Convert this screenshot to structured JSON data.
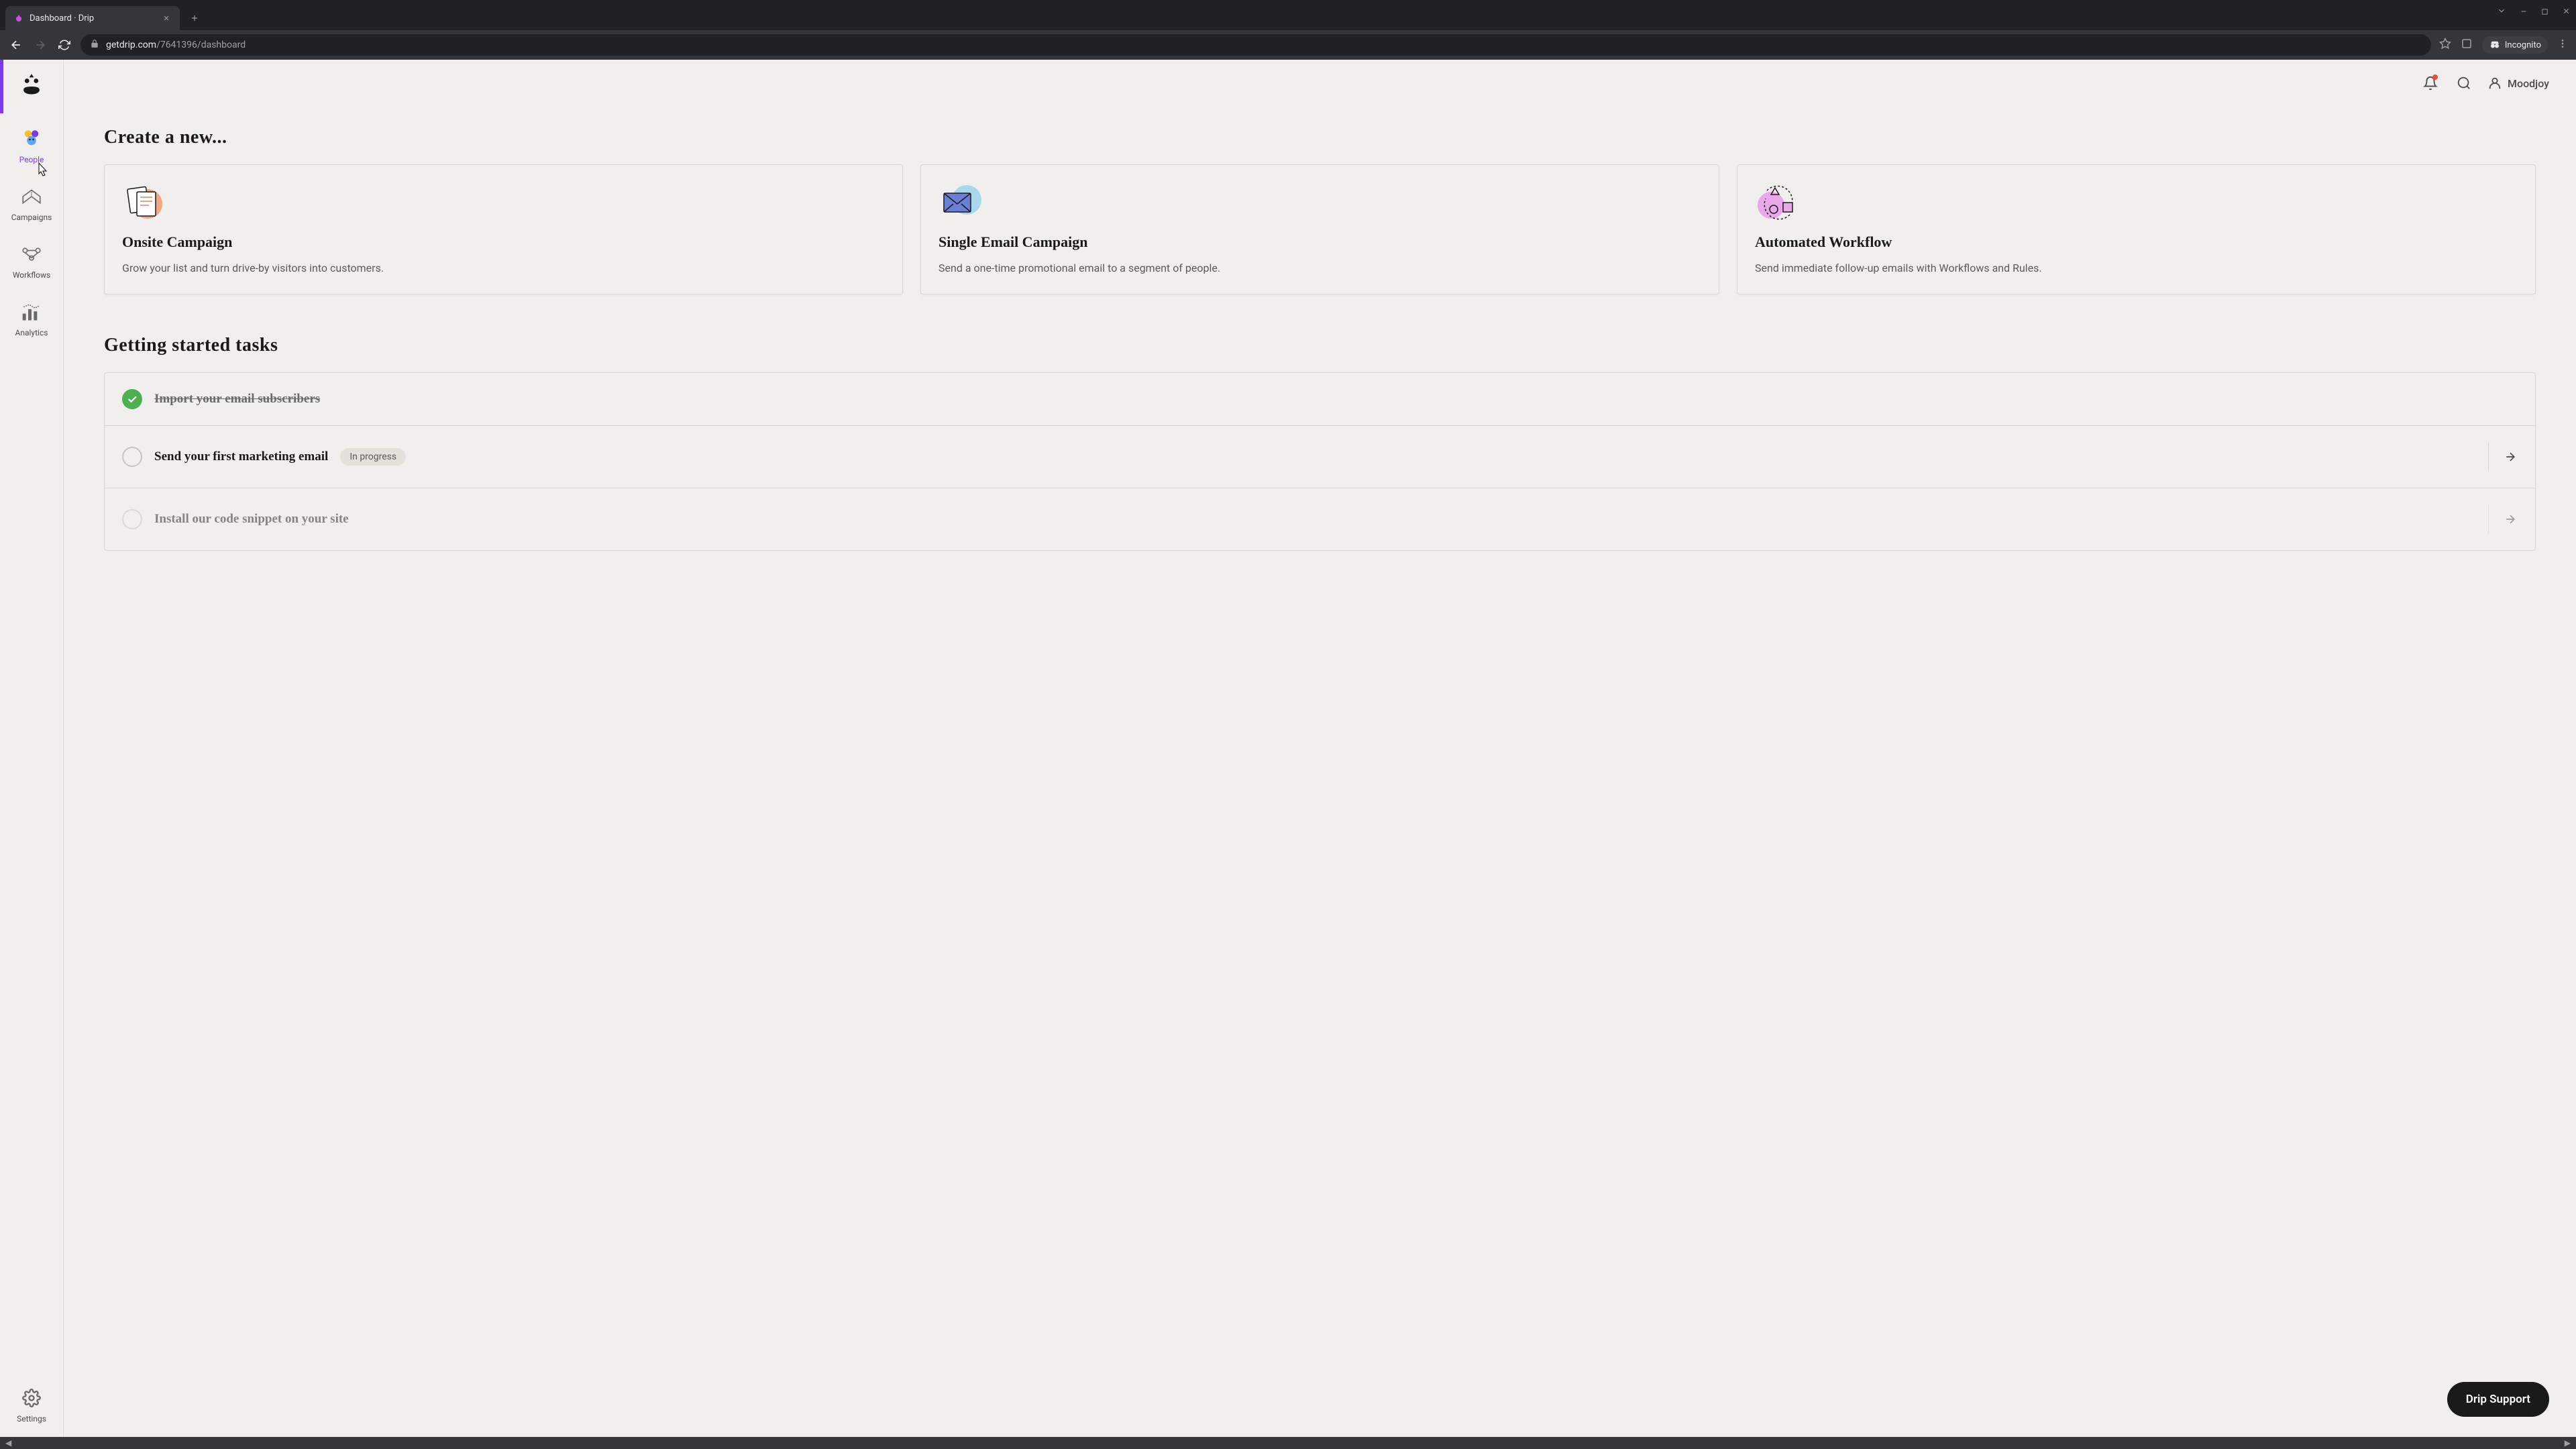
{
  "browser": {
    "tab_title": "Dashboard · Drip",
    "url_domain": "getdrip.com",
    "url_path": "/7641396/dashboard",
    "incognito_label": "Incognito"
  },
  "sidebar": {
    "items": [
      {
        "label": "People"
      },
      {
        "label": "Campaigns"
      },
      {
        "label": "Workflows"
      },
      {
        "label": "Analytics"
      }
    ],
    "settings_label": "Settings"
  },
  "topbar": {
    "username": "Moodjoy"
  },
  "sections": {
    "create_heading": "Create a new...",
    "tasks_heading": "Getting started tasks"
  },
  "cards": [
    {
      "title": "Onsite Campaign",
      "desc": "Grow your list and turn drive-by visitors into customers."
    },
    {
      "title": "Single Email Campaign",
      "desc": "Send a one-time promotional email to a segment of people."
    },
    {
      "title": "Automated Workflow",
      "desc": "Send immediate follow-up emails with Workflows and Rules."
    }
  ],
  "tasks": [
    {
      "title": "Import your email subscribers",
      "done": true,
      "badge": "",
      "arrow": false
    },
    {
      "title": "Send your first marketing email",
      "done": false,
      "badge": "In progress",
      "arrow": true
    },
    {
      "title": "Install our code snippet on your site",
      "done": false,
      "badge": "",
      "arrow": true
    }
  ],
  "support_label": "Drip Support"
}
